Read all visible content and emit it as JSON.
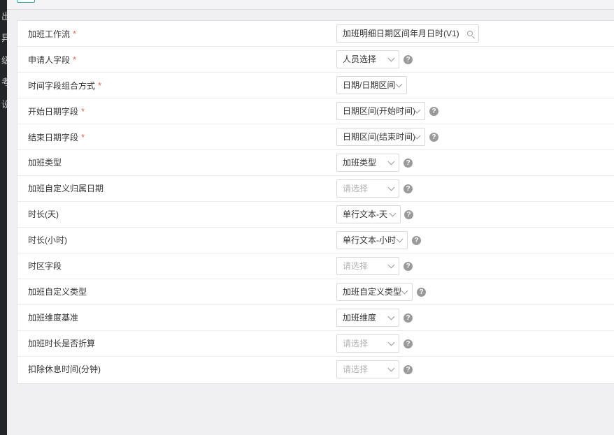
{
  "sidebar": {
    "glyphs": [
      "出",
      "异",
      "级",
      "考",
      "设"
    ]
  },
  "form": {
    "rows": [
      {
        "label": "加班工作流",
        "required": "*",
        "value": "加班明细日期区间年月日时(V1)",
        "kind": "search"
      },
      {
        "label": "申请人字段",
        "required": "*",
        "value": "人员选择",
        "kind": "select",
        "help": "?"
      },
      {
        "label": "时间字段组合方式",
        "required": "*",
        "value": "日期/日期区间",
        "kind": "select"
      },
      {
        "label": "开始日期字段",
        "required": "*",
        "value": "日期区间(开始时间)",
        "kind": "select",
        "help": "?"
      },
      {
        "label": "结束日期字段",
        "required": "*",
        "value": "日期区间(结束时间)",
        "kind": "select",
        "help": "?"
      },
      {
        "label": "加班类型",
        "value": "加班类型",
        "kind": "select",
        "help": "?"
      },
      {
        "label": "加班自定义归属日期",
        "value": "请选择",
        "kind": "placeholder",
        "help": "?"
      },
      {
        "label": "时长(天)",
        "value": "单行文本-天",
        "kind": "select",
        "help": "?"
      },
      {
        "label": "时长(小时)",
        "value": "单行文本-小时",
        "kind": "select",
        "help": "?"
      },
      {
        "label": "时区字段",
        "value": "请选择",
        "kind": "placeholder",
        "help": "?"
      },
      {
        "label": "加班自定义类型",
        "value": "加班自定义类型",
        "kind": "select",
        "help": "?"
      },
      {
        "label": "加班维度基准",
        "value": "加班维度",
        "kind": "select",
        "help": "?"
      },
      {
        "label": "加班时长是否折算",
        "value": "请选择",
        "kind": "placeholder",
        "help": "?"
      },
      {
        "label": "扣除休息时间(分钟)",
        "value": "请选择",
        "kind": "placeholder",
        "help": "?"
      }
    ]
  },
  "colors": {
    "required": "#f0674e",
    "accent": "#2bb3a0",
    "help_bg": "#9a9a9a"
  },
  "icons": {
    "search": "search-icon",
    "chevron": "chevron-down-icon",
    "help": "help-icon"
  }
}
